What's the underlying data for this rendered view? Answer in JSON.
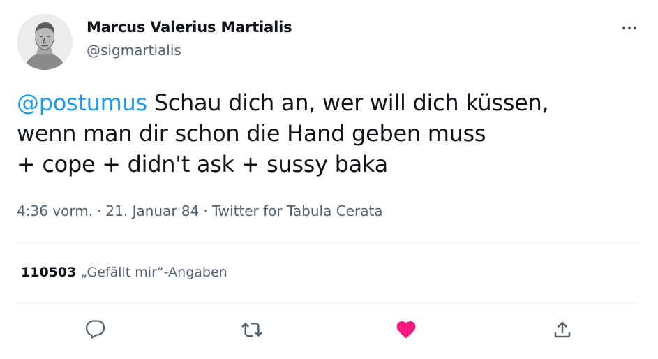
{
  "author": {
    "name": "Marcus Valerius Martialis",
    "handle": "@sigmartialis"
  },
  "tweet": {
    "mention": "@postumus",
    "line1_rest": " Schau dich an, wer will dich küssen,",
    "line2": "wenn man dir schon die Hand geben muss",
    "line3": " + cope + didn't ask + sussy baka"
  },
  "meta": {
    "time": "4:36 vorm.",
    "separator": "·",
    "date": "21. Januar 84",
    "source": "Twitter for Tabula Cerata"
  },
  "stats": {
    "likes_count": "110503",
    "likes_label": "„Gefällt mir“-Angaben"
  },
  "actions": [
    {
      "icon": "reply-icon"
    },
    {
      "icon": "retweet-icon"
    },
    {
      "icon": "like-icon",
      "liked": true
    },
    {
      "icon": "share-icon"
    }
  ],
  "colors": {
    "accent": "#1d9bf0",
    "like": "#f91880",
    "muted": "#536471",
    "text": "#0f1419"
  }
}
